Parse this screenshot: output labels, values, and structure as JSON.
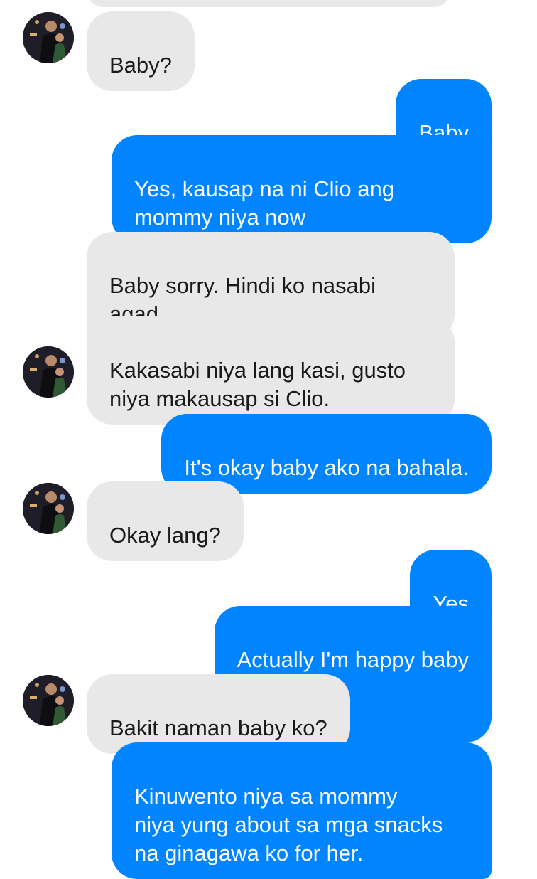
{
  "messages": [
    {
      "id": "m1",
      "side": "in",
      "text": "Baby?"
    },
    {
      "id": "m2",
      "side": "out",
      "text": "Baby"
    },
    {
      "id": "m3",
      "side": "out",
      "text": "Yes, kausap na ni Clio ang\nmommy niya now"
    },
    {
      "id": "m4",
      "side": "in",
      "text": "Baby sorry. Hindi ko nasabi\nagad."
    },
    {
      "id": "m5",
      "side": "in",
      "text": "Kakasabi niya lang kasi, gusto\nniya makausap si Clio."
    },
    {
      "id": "m6",
      "side": "out",
      "text": "It's okay baby ako na bahala."
    },
    {
      "id": "m7",
      "side": "in",
      "text": "Okay lang?"
    },
    {
      "id": "m8",
      "side": "out",
      "text": "Yes",
      "emoji": "smiling-face-with-hearts-icon"
    },
    {
      "id": "m9",
      "side": "out",
      "text": "Actually I'm happy baby",
      "emoji": "pointing-fingers-icon"
    },
    {
      "id": "m10",
      "side": "in",
      "text": "Bakit naman baby ko?"
    },
    {
      "id": "m11",
      "side": "out",
      "text": "Kinuwento niya sa mommy\nniya yung about sa mga snacks\nna ginagawa ko for her."
    }
  ],
  "colors": {
    "outgoing_bubble": "#0084ff",
    "incoming_bubble": "#e8e8e8",
    "outgoing_text": "#ffffff",
    "incoming_text": "#1a1a1a"
  }
}
